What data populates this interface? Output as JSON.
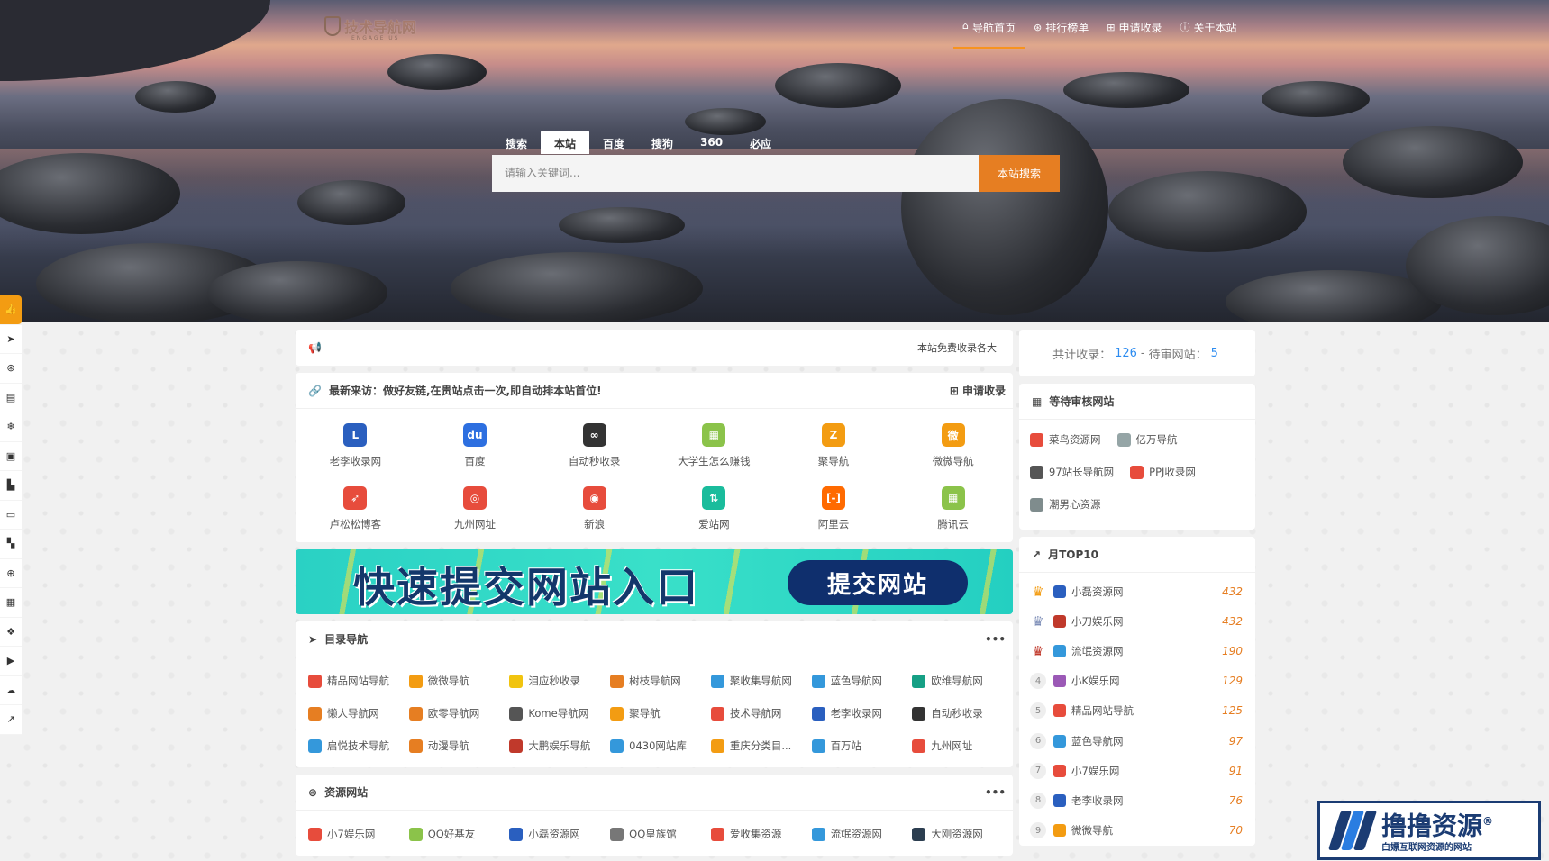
{
  "logo": {
    "text": "技术导航网",
    "sub": "ENGAGE US"
  },
  "topnav": [
    {
      "label": "导航首页",
      "icon": "home-icon"
    },
    {
      "label": "排行榜单",
      "icon": "ranking-icon"
    },
    {
      "label": "申请收录",
      "icon": "plus-square-icon"
    },
    {
      "label": "关于本站",
      "icon": "info-icon"
    }
  ],
  "search": {
    "tabs": [
      "搜索",
      "本站",
      "百度",
      "搜狗",
      "360",
      "必应"
    ],
    "active_tab": "本站",
    "placeholder": "请输入关键词...",
    "button": "本站搜索"
  },
  "sidebar_icons": [
    "thumbs-up-icon",
    "paper-plane-icon",
    "ranking-icon",
    "document-icon",
    "snowflake-icon",
    "image-icon",
    "chart-icon",
    "card-icon",
    "map-icon",
    "support-icon",
    "grid-icon",
    "cubes-icon",
    "video-icon",
    "cloud-icon",
    "line-chart-icon"
  ],
  "notice": {
    "text": "本站免费收录各大"
  },
  "recent": {
    "title": "最新来访：做好友链,在贵站点击一次,即自动排本站首位!",
    "apply": "申请收录",
    "items": [
      {
        "name": "老李收录网",
        "color": "#2a5fbf",
        "glyph": "L"
      },
      {
        "name": "百度",
        "color": "#2d6fe0",
        "glyph": "du"
      },
      {
        "name": "自动秒收录",
        "color": "#333333",
        "glyph": "∞"
      },
      {
        "name": "大学生怎么赚钱",
        "color": "#8bc34a",
        "glyph": "▦"
      },
      {
        "name": "聚导航",
        "color": "#f39c12",
        "glyph": "Z"
      },
      {
        "name": "微微导航",
        "color": "#f39c12",
        "glyph": "微"
      },
      {
        "name": "卢松松博客",
        "color": "#e74c3c",
        "glyph": "➶"
      },
      {
        "name": "九州网址",
        "color": "#e74c3c",
        "glyph": "◎"
      },
      {
        "name": "新浪",
        "color": "#e74c3c",
        "glyph": "◉"
      },
      {
        "name": "爱站网",
        "color": "#1abc9c",
        "glyph": "⇅"
      },
      {
        "name": "阿里云",
        "color": "#ff6a00",
        "glyph": "[-]"
      },
      {
        "name": "腾讯云",
        "color": "#8bc34a",
        "glyph": "▦"
      }
    ]
  },
  "banner": {
    "title": "快速提交网站入口",
    "button": "提交网站"
  },
  "catalog": {
    "title": "目录导航",
    "more": "•••",
    "items": [
      {
        "name": "精品网站导航",
        "color": "#e74c3c"
      },
      {
        "name": "微微导航",
        "color": "#f39c12"
      },
      {
        "name": "泪应秒收录",
        "color": "#f1c40f"
      },
      {
        "name": "树枝导航网",
        "color": "#e67e22"
      },
      {
        "name": "聚收集导航网",
        "color": "#3498db"
      },
      {
        "name": "蓝色导航网",
        "color": "#3498db"
      },
      {
        "name": "欧维导航网",
        "color": "#16a085"
      },
      {
        "name": "懒人导航网",
        "color": "#e67e22"
      },
      {
        "name": "欧零导航网",
        "color": "#e67e22"
      },
      {
        "name": "Kome导航网",
        "color": "#555555"
      },
      {
        "name": "聚导航",
        "color": "#f39c12"
      },
      {
        "name": "技术导航网",
        "color": "#e74c3c"
      },
      {
        "name": "老李收录网",
        "color": "#2a5fbf"
      },
      {
        "name": "自动秒收录",
        "color": "#333333"
      },
      {
        "name": "启悦技术导航",
        "color": "#3498db"
      },
      {
        "name": "动漫导航",
        "color": "#e67e22"
      },
      {
        "name": "大鹏娱乐导航",
        "color": "#c0392b"
      },
      {
        "name": "0430网站库",
        "color": "#3498db"
      },
      {
        "name": "重庆分类目...",
        "color": "#f39c12"
      },
      {
        "name": "百万站",
        "color": "#3498db"
      },
      {
        "name": "九州网址",
        "color": "#e74c3c"
      }
    ]
  },
  "resources": {
    "title": "资源网站",
    "more": "•••",
    "items": [
      {
        "name": "小7娱乐网",
        "color": "#e74c3c"
      },
      {
        "name": "QQ好基友",
        "color": "#8bc34a"
      },
      {
        "name": "小磊资源网",
        "color": "#2a5fbf"
      },
      {
        "name": "QQ皇族馆",
        "color": "#777777"
      },
      {
        "name": "爱收集资源",
        "color": "#e74c3c"
      },
      {
        "name": "流氓资源网",
        "color": "#3498db"
      },
      {
        "name": "大刚资源网",
        "color": "#2c3e50"
      }
    ]
  },
  "stats": {
    "label1": "共计收录：",
    "count": "126",
    "sep": "-",
    "label2": "待审网站：",
    "pending": "5"
  },
  "pending": {
    "title": "等待审核网站",
    "items": [
      {
        "name": "菜鸟资源网",
        "color": "#e74c3c"
      },
      {
        "name": "亿万导航",
        "color": "#95a5a6"
      },
      {
        "name": "97站长导航网",
        "color": "#555555"
      },
      {
        "name": "PPJ收录网",
        "color": "#e74c3c"
      },
      {
        "name": "潮男心资源",
        "color": "#7f8c8d"
      }
    ]
  },
  "top10": {
    "title": "月TOP10",
    "items": [
      {
        "rank": "1",
        "name": "小磊资源网",
        "value": "432",
        "color": "#2a5fbf"
      },
      {
        "rank": "2",
        "name": "小刀娱乐网",
        "value": "432",
        "color": "#c0392b"
      },
      {
        "rank": "3",
        "name": "流氓资源网",
        "value": "190",
        "color": "#3498db"
      },
      {
        "rank": "4",
        "name": "小K娱乐网",
        "value": "129",
        "color": "#9b59b6"
      },
      {
        "rank": "5",
        "name": "精品网站导航",
        "value": "125",
        "color": "#e74c3c"
      },
      {
        "rank": "6",
        "name": "蓝色导航网",
        "value": "97",
        "color": "#3498db"
      },
      {
        "rank": "7",
        "name": "小7娱乐网",
        "value": "91",
        "color": "#e74c3c"
      },
      {
        "rank": "8",
        "name": "老李收录网",
        "value": "76",
        "color": "#2a5fbf"
      },
      {
        "rank": "9",
        "name": "微微导航",
        "value": "70",
        "color": "#f39c12"
      }
    ]
  },
  "watermark": {
    "title": "撸撸资源",
    "reg": "®",
    "sub": "白嫖互联网资源的网站"
  },
  "colors": {
    "accent": "#e67e22",
    "link_blue": "#2d8cf0"
  }
}
